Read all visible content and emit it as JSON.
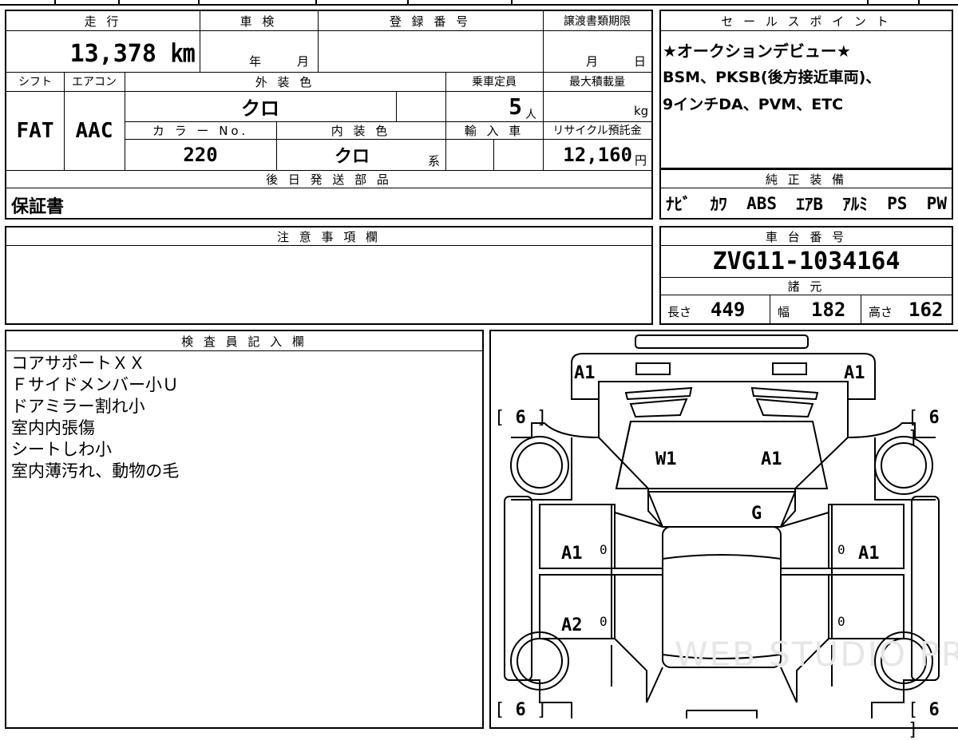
{
  "vehicle": {
    "mileage_header": "走 行",
    "mileage": "13,378 ㎞",
    "inspection_header": "車 検",
    "inspection_year_unit": "年",
    "inspection_month_unit": "月",
    "registration_header": "登 録 番 号",
    "registration_value": "",
    "transfer_deadline_header": "譲渡書類期限",
    "transfer_month_unit": "月",
    "transfer_day_unit": "日",
    "shift_header": "シフト",
    "shift": "FAT",
    "ac_header": "エアコン",
    "ac": "AAC",
    "exterior_color_header": "外 装 色",
    "exterior_color": "クロ",
    "capacity_header": "乗車定員",
    "capacity": "5",
    "capacity_unit": "人",
    "max_load_header": "最大積載量",
    "max_load_unit": "kg",
    "color_no_header": "カ ラ ー No.",
    "color_no": "220",
    "interior_color_header": "内 装 色",
    "interior_color": "クロ",
    "interior_color_suffix": "系",
    "import_header": "輸 入 車",
    "recycle_header": "リサイクル預託金",
    "recycle_fee": "12,160",
    "recycle_unit": "円",
    "later_parts_header": "後 日 発 送 部 品",
    "later_parts": "保証書"
  },
  "sales_points": {
    "header": "セ ー ル ス ポ イ ン ト",
    "lines": [
      "★オークションデビュー★",
      "BSM、PKSB(後方接近車両)、",
      "9インチDA、PVM、ETC"
    ]
  },
  "equipment": {
    "header": "純 正 装 備",
    "items": [
      "ﾅﾋﾞ",
      "ｶﾜ",
      "ABS",
      "ｴｱB",
      "ｱﾙﾐ",
      "PS",
      "PW"
    ]
  },
  "notes": {
    "header": "注 意 事 項 欄",
    "text": ""
  },
  "chassis": {
    "header": "車 台 番 号",
    "number": "ZVG11-1034164",
    "specs_header": "諸 元",
    "length_label": "長さ",
    "length": "449",
    "width_label": "幅",
    "width": "182",
    "height_label": "高さ",
    "height": "162"
  },
  "inspector": {
    "header": "検 査 員 記 入 欄",
    "lines": [
      "コアサポートＸＸ",
      "Ｆサイドメンバー小Ｕ",
      "ドアミラー割れ小",
      "室内内張傷",
      "シートしわ小",
      "室内薄汚れ、動物の毛"
    ]
  },
  "diagram": {
    "front_left": "A1",
    "front_right": "A1",
    "windshield": "W1",
    "hood": "A1",
    "roof": "G",
    "front_door_left": "A1",
    "front_door_right": "A1",
    "rear_door_left": "A2",
    "door_marks": [
      "0",
      "0",
      "0",
      "0"
    ],
    "tire_tl": "6",
    "tire_tr": "6",
    "tire_bl": "6",
    "tire_br": "6",
    "watermark": "WEB STUDIO PRO"
  }
}
